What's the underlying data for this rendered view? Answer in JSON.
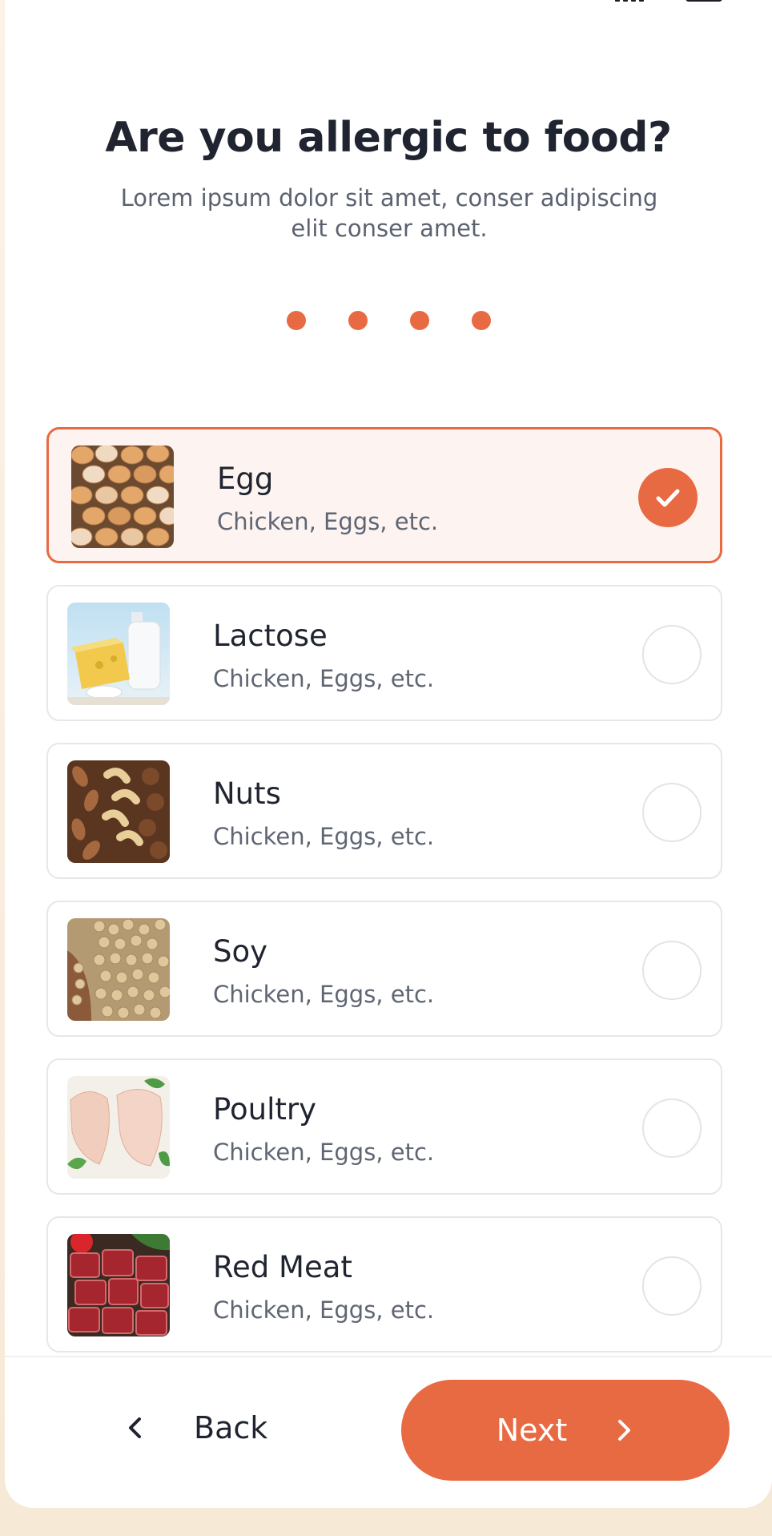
{
  "header": {
    "title": "Are you allergic to food?",
    "subtitle": "Lorem ipsum dolor sit amet, conser adipiscing elit conser amet."
  },
  "progress": {
    "steps": 4
  },
  "options": [
    {
      "name": "Egg",
      "desc": "Chicken, Eggs, etc.",
      "selected": true,
      "icon": "egg-photo"
    },
    {
      "name": "Lactose",
      "desc": "Chicken, Eggs, etc.",
      "selected": false,
      "icon": "milk-cheese-photo"
    },
    {
      "name": "Nuts",
      "desc": "Chicken, Eggs, etc.",
      "selected": false,
      "icon": "nuts-photo"
    },
    {
      "name": "Soy",
      "desc": "Chicken, Eggs, etc.",
      "selected": false,
      "icon": "soybeans-photo"
    },
    {
      "name": "Poultry",
      "desc": "Chicken, Eggs, etc.",
      "selected": false,
      "icon": "chicken-breast-photo"
    },
    {
      "name": "Red Meat",
      "desc": "Chicken, Eggs, etc.",
      "selected": false,
      "icon": "red-meat-photo"
    }
  ],
  "footer": {
    "back_label": "Back",
    "next_label": "Next"
  },
  "colors": {
    "accent": "#e86a43",
    "selected_bg": "#fdf4f1",
    "title": "#1f2430",
    "muted": "#5b6270"
  }
}
